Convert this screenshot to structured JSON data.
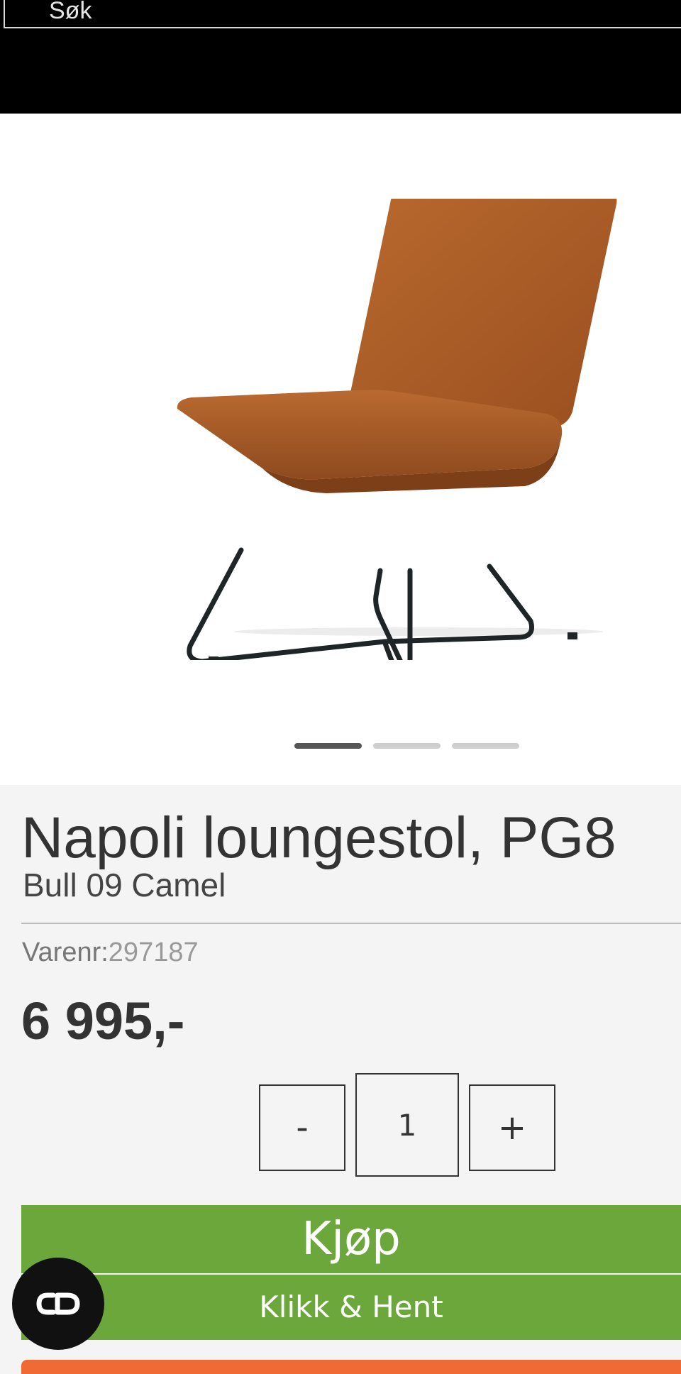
{
  "search": {
    "placeholder": "Søk"
  },
  "gallery": {
    "image_alt": "Napoli loungestol camel leather chair",
    "slides": 3,
    "active_slide": 1
  },
  "product": {
    "title": "Napoli loungestol, PG8",
    "variant": "Bull 09 Camel",
    "sku_label": "Varenr:",
    "sku_value": "297187",
    "price": "6 995,-"
  },
  "quantity": {
    "minus_label": "-",
    "value": "1",
    "plus_label": "+"
  },
  "actions": {
    "buy_label": "Kjøp",
    "pickup_label": "Klikk & Hent"
  },
  "colors": {
    "header": "#000000",
    "buy": "#6ba73b",
    "accent_orange": "#f06a35",
    "active_dot": "#555555"
  },
  "icons": {
    "accessibility": "accessibility-icon"
  }
}
